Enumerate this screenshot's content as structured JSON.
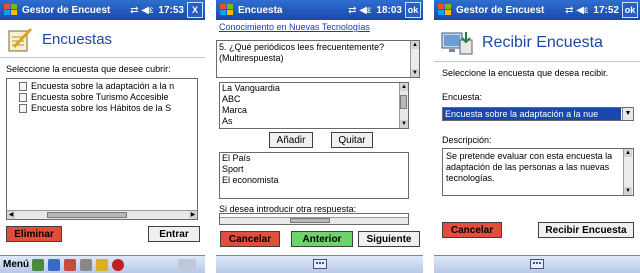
{
  "screen1": {
    "app_title": "Gestor de Encuest",
    "status_icons": "⇄ ◀ε",
    "time": "17:53",
    "close_label": "X",
    "header_title": "Encuestas",
    "instruction": "Seleccione la encuesta que desee cubrir:",
    "surveys": [
      "Encuesta sobre la adaptación a la n",
      "Encuesta sobre Turismo Accesible",
      "Encuesta sobre los Hábitos de la S"
    ],
    "delete_button": "Eliminar",
    "enter_button": "Entrar",
    "menu_label": "Menú",
    "tray_colors": [
      "#4a8a3a",
      "#3a6ac8",
      "#c84a3a",
      "#888888",
      "#d8b020",
      "#c02020"
    ]
  },
  "screen2": {
    "app_title": "Encuesta",
    "status_icons": "⇄ ◀ε",
    "time": "18:03",
    "ok_label": "ok",
    "link_text": "Conocimiento en Nuevas Tecnologías",
    "question": "5. ¿Qué periódicos lees frecuentemente? (Multirespuesta)",
    "options": [
      "La Vanguardia",
      "ABC",
      "Marca",
      "As"
    ],
    "add_button": "Añadir",
    "remove_button": "Quitar",
    "selected": [
      "El País",
      "Sport",
      "El economista"
    ],
    "other_prompt": "Si desea introducir otra respuesta:",
    "cancel_button": "Cancelar",
    "previous_button": "Anterior",
    "next_button": "Siguiente"
  },
  "screen3": {
    "app_title": "Gestor de Encuest",
    "status_icons": "⇄ ◀ε",
    "time": "17:52",
    "ok_label": "ok",
    "header_title": "Recibir Encuesta",
    "instruction": "Seleccione la encuesta que desea recibir.",
    "survey_label": "Encuesta:",
    "survey_value": "Encuesta sobre la adaptación a la nue",
    "description_label": "Descripción:",
    "description_text": "Se pretende evaluar con esta encuesta la adaptación de las personas a las nuevas tecnologías.",
    "cancel_button": "Cancelar",
    "receive_button": "Recibir Encuesta"
  }
}
